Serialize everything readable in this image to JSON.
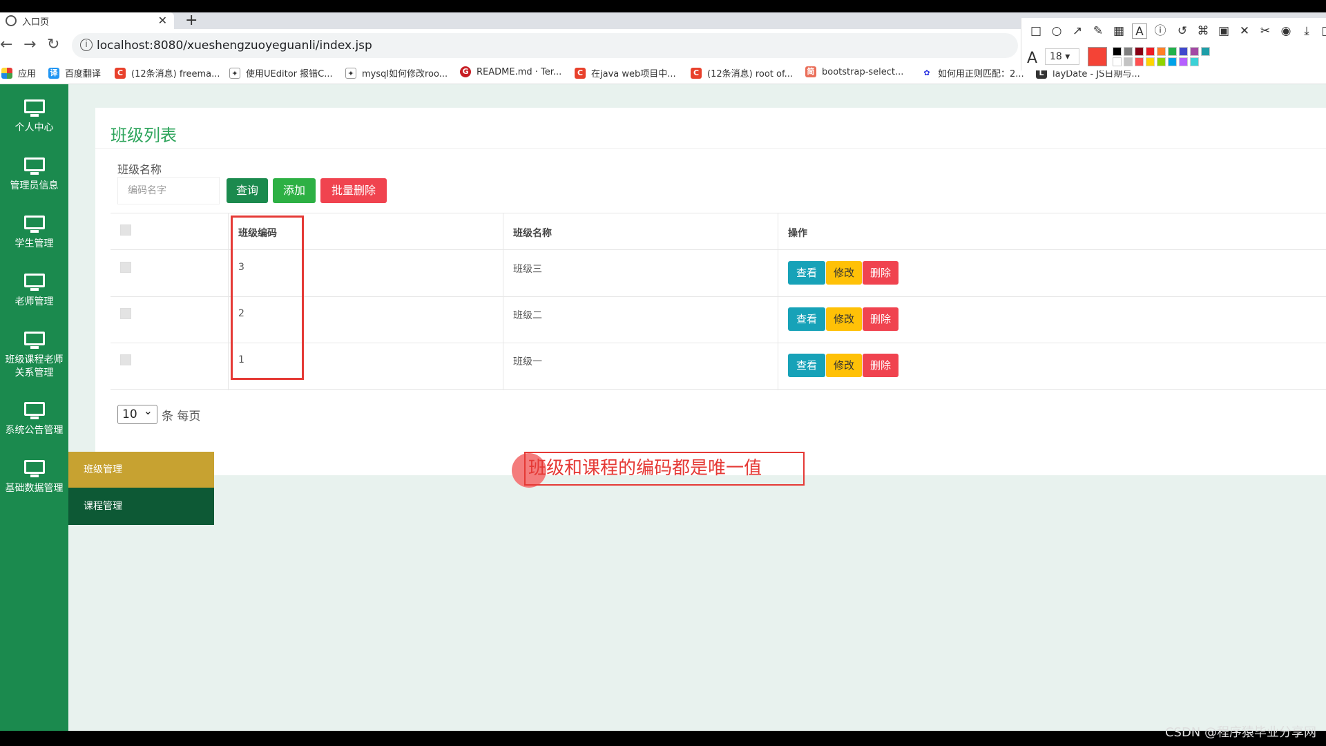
{
  "browser": {
    "tab_title": "入口页",
    "tab_close": "✕",
    "new_tab": "+",
    "url": "localhost:8080/xueshengzuoyeguanli/index.jsp",
    "nav_back": "←",
    "nav_forward": "→",
    "nav_reload": "↻",
    "url_info": "i"
  },
  "bookmarks": [
    {
      "label": "应用",
      "icon": "apps-icon"
    },
    {
      "label": "百度翻译",
      "icon": "baidu-translate-icon"
    },
    {
      "label": "(12条消息) freema...",
      "icon": "csdn-icon"
    },
    {
      "label": "使用UEditor 报错C...",
      "icon": "bookmark-icon"
    },
    {
      "label": "mysql如何修改roo...",
      "icon": "bookmark-icon"
    },
    {
      "label": "README.md · Ter...",
      "icon": "gitee-icon"
    },
    {
      "label": "在java web项目中...",
      "icon": "csdn-icon"
    },
    {
      "label": "(12条消息) root of...",
      "icon": "csdn-icon"
    },
    {
      "label": "bootstrap-select...",
      "icon": "jianshu-icon"
    },
    {
      "label": "如何用正则匹配：2...",
      "icon": "baidu-icon"
    },
    {
      "label": "layDate - JS日期与...",
      "icon": "bookmark-icon"
    }
  ],
  "annotation_toolbar": {
    "font_size": "18",
    "font_label": "A",
    "active_color": "#f44336",
    "palette": [
      "#000000",
      "#7f7f7f",
      "#880015",
      "#ed1c24",
      "#ff7f27",
      "#22b14c",
      "#3f48cc",
      "#a349a4",
      "#1e9ea8",
      "#ffffff",
      "#c3c3c3",
      "#ff5050",
      "#ffd400",
      "#8fd400",
      "#00a2e8",
      "#b55fff",
      "#3bd1d6"
    ]
  },
  "sidebar": {
    "items": [
      {
        "label": "个人中心"
      },
      {
        "label": "管理员信息"
      },
      {
        "label": "学生管理"
      },
      {
        "label": "老师管理"
      },
      {
        "label": "班级课程老师关系管理"
      },
      {
        "label": "系统公告管理"
      },
      {
        "label": "基础数据管理"
      }
    ],
    "submenu": [
      {
        "label": "班级管理"
      },
      {
        "label": "课程管理"
      }
    ]
  },
  "main": {
    "title": "班级列表",
    "search_label": "班级名称",
    "search_placeholder": "编码名字",
    "btn_query": "查询",
    "btn_add": "添加",
    "btn_bulk_delete": "批量删除",
    "columns": [
      "班级编码",
      "班级名称",
      "操作"
    ],
    "rows": [
      {
        "code": "3",
        "name": "班级三"
      },
      {
        "code": "2",
        "name": "班级二"
      },
      {
        "code": "1",
        "name": "班级一"
      }
    ],
    "action_view": "查看",
    "action_edit": "修改",
    "action_delete": "删除",
    "page_size": "10",
    "page_size_suffix": "条 每页"
  },
  "annotation": {
    "text": "班级和课程的编码都是唯一值"
  },
  "watermark": "CSDN @程序猿毕业分享网",
  "colors": {
    "sidebar": "#1b8a4e",
    "title": "#2da45b",
    "submenu_active": "#c7a231",
    "submenu_dark": "#0d5935",
    "danger": "#f0434f",
    "info": "#17a2b8",
    "warning": "#ffc107"
  }
}
